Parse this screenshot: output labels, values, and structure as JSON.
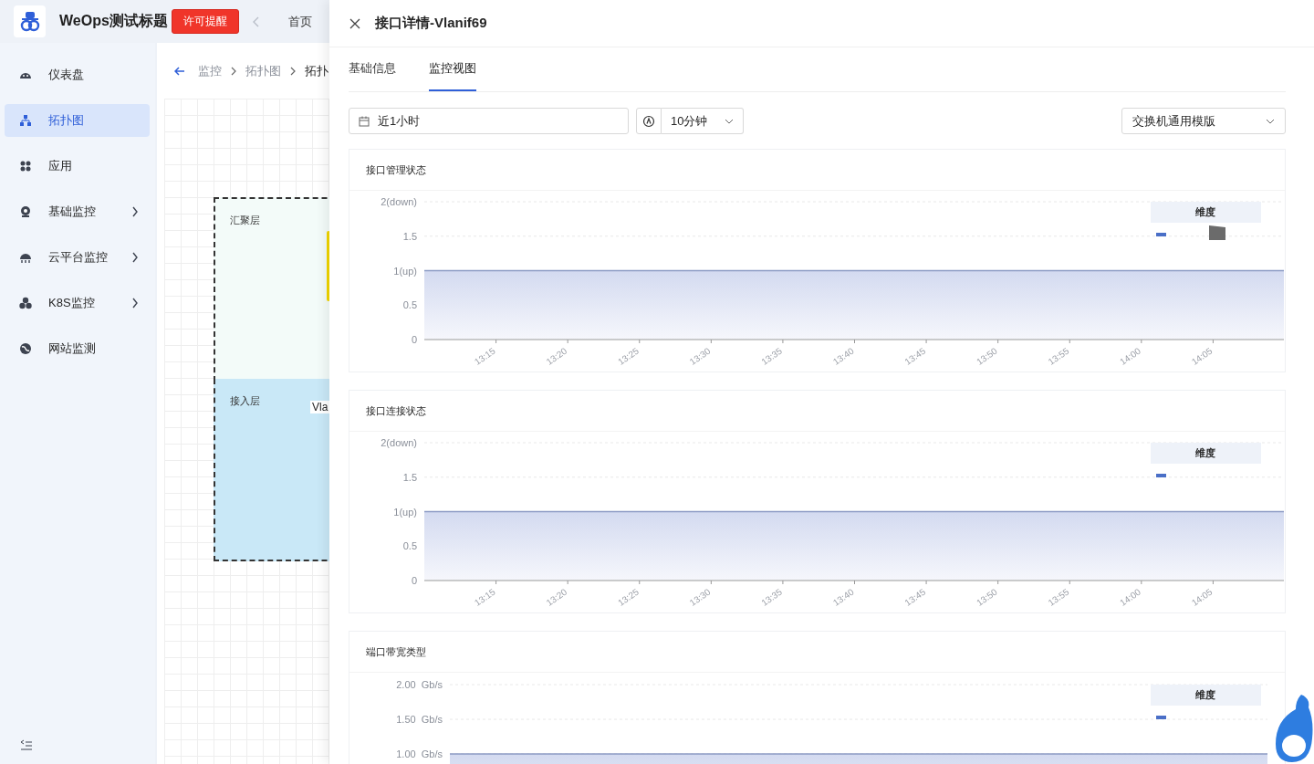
{
  "app": {
    "title": "WeOps测试标题",
    "license_button": "许可提醒",
    "home_tab": "首页"
  },
  "sidebar": {
    "items": [
      {
        "label": "仪表盘",
        "selected": false,
        "expandable": false
      },
      {
        "label": "拓扑图",
        "selected": true,
        "expandable": false
      },
      {
        "label": "应用",
        "selected": false,
        "expandable": false
      },
      {
        "label": "基础监控",
        "selected": false,
        "expandable": true
      },
      {
        "label": "云平台监控",
        "selected": false,
        "expandable": true
      },
      {
        "label": "K8S监控",
        "selected": false,
        "expandable": true
      },
      {
        "label": "网站监测",
        "selected": false,
        "expandable": false
      }
    ]
  },
  "breadcrumb": [
    "监控",
    "拓扑图",
    "拓扑"
  ],
  "canvas": {
    "groups": [
      {
        "label": "汇聚层",
        "color": "#f3fbf9"
      },
      {
        "label": "接入层",
        "color": "#c9e8f7"
      }
    ],
    "node_label": "Vla"
  },
  "drawer": {
    "title": "接口详情-Vlanif69",
    "tabs": [
      {
        "label": "基础信息",
        "selected": false
      },
      {
        "label": "监控视图",
        "selected": true
      }
    ],
    "time_range": "近1小时",
    "refresh_interval": "10分钟",
    "template": "交换机通用模版",
    "charts": [
      {
        "title": "接口管理状态",
        "legend_title": "维度",
        "legend_items": [
          {
            "kind": "dash",
            "color": "#4a6fc7"
          },
          {
            "kind": "square",
            "color": "#6b6b6b"
          }
        ],
        "chart_data": {
          "type": "area",
          "categories": [
            null,
            "13:15",
            "13:20",
            "13:25",
            "13:30",
            "13:35",
            "13:40",
            "13:45",
            "13:50",
            "13:55",
            "14:00",
            "14:05",
            null
          ],
          "series": [
            {
              "color": "#8c9bc4",
              "values": [
                1,
                1,
                1,
                1,
                1,
                1,
                1,
                1,
                1,
                1,
                1,
                1,
                1
              ]
            }
          ],
          "ylim": [
            0,
            2
          ],
          "yticks": [
            {
              "value": 0,
              "label": "0"
            },
            {
              "value": 0.5,
              "label": "0.5"
            },
            {
              "value": 1,
              "label": "1(up)"
            },
            {
              "value": 1.5,
              "label": "1.5"
            },
            {
              "value": 2,
              "label": "2(down)"
            }
          ]
        }
      },
      {
        "title": "接口连接状态",
        "legend_title": "维度",
        "legend_items": [
          {
            "kind": "dash",
            "color": "#4a6fc7"
          }
        ],
        "chart_data": {
          "type": "area",
          "categories": [
            null,
            "13:15",
            "13:20",
            "13:25",
            "13:30",
            "13:35",
            "13:40",
            "13:45",
            "13:50",
            "13:55",
            "14:00",
            "14:05",
            null
          ],
          "series": [
            {
              "color": "#8c9bc4",
              "values": [
                1,
                1,
                1,
                1,
                1,
                1,
                1,
                1,
                1,
                1,
                1,
                1,
                1
              ]
            }
          ],
          "ylim": [
            0,
            2
          ],
          "yticks": [
            {
              "value": 0,
              "label": "0"
            },
            {
              "value": 0.5,
              "label": "0.5"
            },
            {
              "value": 1,
              "label": "1(up)"
            },
            {
              "value": 1.5,
              "label": "1.5"
            },
            {
              "value": 2,
              "label": "2(down)"
            }
          ]
        }
      },
      {
        "title": "端口带宽类型",
        "legend_title": "维度",
        "legend_items": [
          {
            "kind": "dash",
            "color": "#4a6fc7"
          }
        ],
        "chart_data": {
          "type": "area",
          "categories": [
            null,
            null,
            null
          ],
          "series": [
            {
              "color": "#8c9bc4",
              "values": [
                1,
                1,
                1
              ]
            }
          ],
          "ylim": [
            0,
            2
          ],
          "yticks": [
            {
              "value": 1,
              "label": "1.00  Gb/s"
            },
            {
              "value": 1.5,
              "label": "1.50  Gb/s"
            },
            {
              "value": 2,
              "label": "2.00  Gb/s"
            }
          ]
        }
      }
    ]
  }
}
